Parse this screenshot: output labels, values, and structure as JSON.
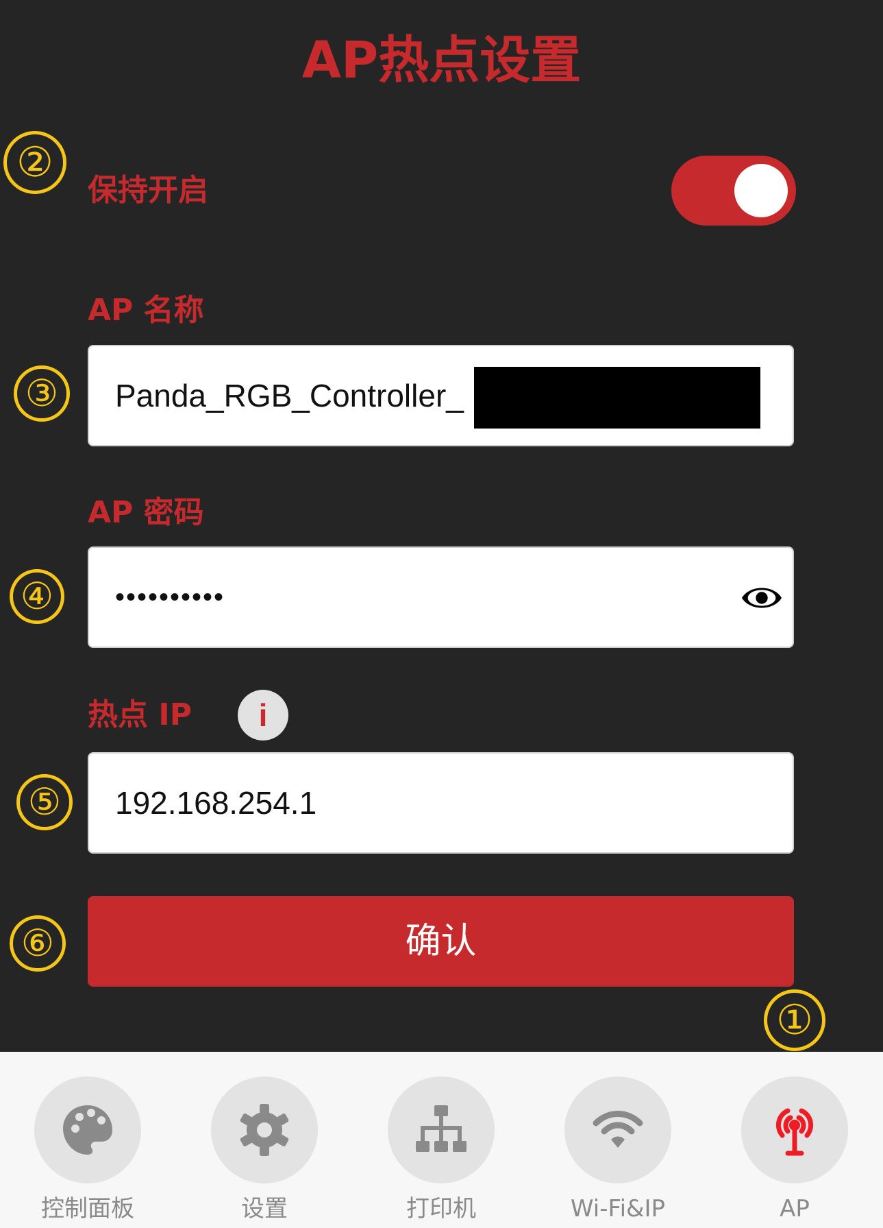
{
  "page": {
    "title": "AP热点设置"
  },
  "markers": {
    "m1": "①",
    "m2": "②",
    "m3": "③",
    "m4": "④",
    "m5": "⑤",
    "m6": "⑥"
  },
  "keep_on": {
    "label": "保持开启",
    "enabled": true
  },
  "ap_name": {
    "label": "AP 名称",
    "value": "Panda_RGB_Controller_"
  },
  "ap_password": {
    "label": "AP 密码",
    "value": "••••••••••"
  },
  "hotspot_ip": {
    "label": "热点 IP",
    "info_glyph": "i",
    "value": "192.168.254.1"
  },
  "confirm": {
    "label": "确认"
  },
  "tabs": [
    {
      "label": "控制面板",
      "icon": "palette-icon",
      "active": false
    },
    {
      "label": "设置",
      "icon": "gear-icon",
      "active": false
    },
    {
      "label": "打印机",
      "icon": "network-icon",
      "active": false
    },
    {
      "label": "Wi-Fi&IP",
      "icon": "wifi-icon",
      "active": false
    },
    {
      "label": "AP",
      "icon": "hotspot-icon",
      "active": true
    }
  ],
  "colors": {
    "accent": "#c62a2c",
    "marker": "#f5c518",
    "background": "#262526",
    "tab_inactive": "#8a8a8a"
  }
}
